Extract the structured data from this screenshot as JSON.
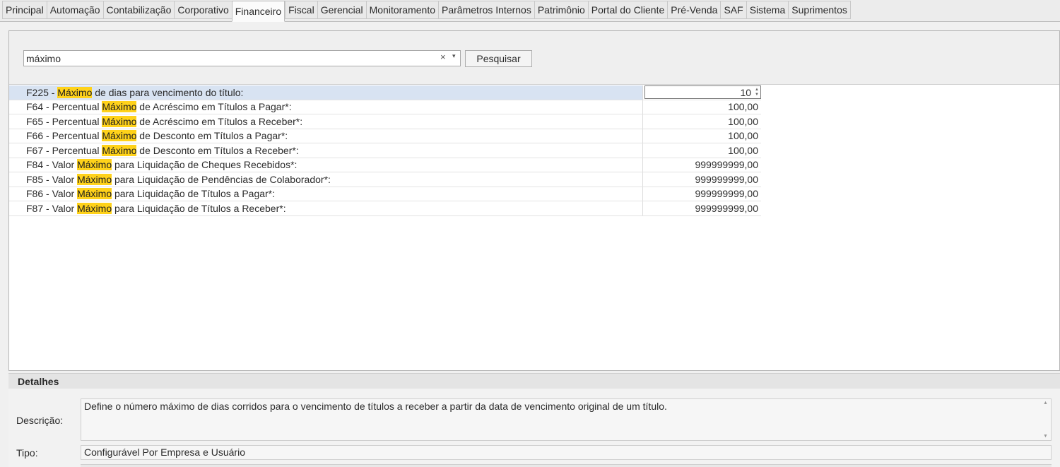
{
  "tabs": [
    {
      "label": "Principal",
      "active": false
    },
    {
      "label": "Automação",
      "active": false
    },
    {
      "label": "Contabilização",
      "active": false
    },
    {
      "label": "Corporativo",
      "active": false
    },
    {
      "label": "Financeiro",
      "active": true
    },
    {
      "label": "Fiscal",
      "active": false
    },
    {
      "label": "Gerencial",
      "active": false
    },
    {
      "label": "Monitoramento",
      "active": false
    },
    {
      "label": "Parâmetros Internos",
      "active": false
    },
    {
      "label": "Patrimônio",
      "active": false
    },
    {
      "label": "Portal do Cliente",
      "active": false
    },
    {
      "label": "Pré-Venda",
      "active": false
    },
    {
      "label": "SAF",
      "active": false
    },
    {
      "label": "Sistema",
      "active": false
    },
    {
      "label": "Suprimentos",
      "active": false
    }
  ],
  "search": {
    "value": "máximo",
    "clear_icon": "×",
    "dropdown_icon": "▾",
    "button_label": "Pesquisar"
  },
  "highlight_color": "#ffd21a",
  "selected_row_color": "#d8e3f2",
  "parameters": [
    {
      "prefix": "F225 - ",
      "highlight": "Máximo",
      "suffix": " de dias para vencimento do título:",
      "value": "10",
      "editing": true
    },
    {
      "prefix": "F64 - Percentual ",
      "highlight": "Máximo",
      "suffix": " de Acréscimo em Títulos a Pagar*:",
      "value": "100,00",
      "editing": false
    },
    {
      "prefix": "F65 - Percentual ",
      "highlight": "Máximo",
      "suffix": " de Acréscimo em Títulos a Receber*:",
      "value": "100,00",
      "editing": false
    },
    {
      "prefix": "F66 - Percentual ",
      "highlight": "Máximo",
      "suffix": " de Desconto em Títulos a Pagar*:",
      "value": "100,00",
      "editing": false
    },
    {
      "prefix": "F67 - Percentual ",
      "highlight": "Máximo",
      "suffix": " de Desconto em Títulos a Receber*:",
      "value": "100,00",
      "editing": false
    },
    {
      "prefix": "F84 - Valor ",
      "highlight": "Máximo",
      "suffix": " para Liquidação de Cheques Recebidos*:",
      "value": "999999999,00",
      "editing": false
    },
    {
      "prefix": "F85 - Valor ",
      "highlight": "Máximo",
      "suffix": " para Liquidação de Pendências de Colaborador*:",
      "value": "999999999,00",
      "editing": false
    },
    {
      "prefix": "F86 - Valor ",
      "highlight": "Máximo",
      "suffix": " para Liquidação de Títulos a Pagar*:",
      "value": "999999999,00",
      "editing": false
    },
    {
      "prefix": "F87 - Valor ",
      "highlight": "Máximo",
      "suffix": " para Liquidação de Títulos a Receber*:",
      "value": "999999999,00",
      "editing": false
    }
  ],
  "details": {
    "header": "Detalhes",
    "description_label": "Descrição:",
    "description": "Define o número máximo de dias corridos para o vencimento de títulos a receber a partir da data de vencimento original de um título.",
    "type_label": "Tipo:",
    "type": "Configurável Por Empresa e Usuário"
  }
}
